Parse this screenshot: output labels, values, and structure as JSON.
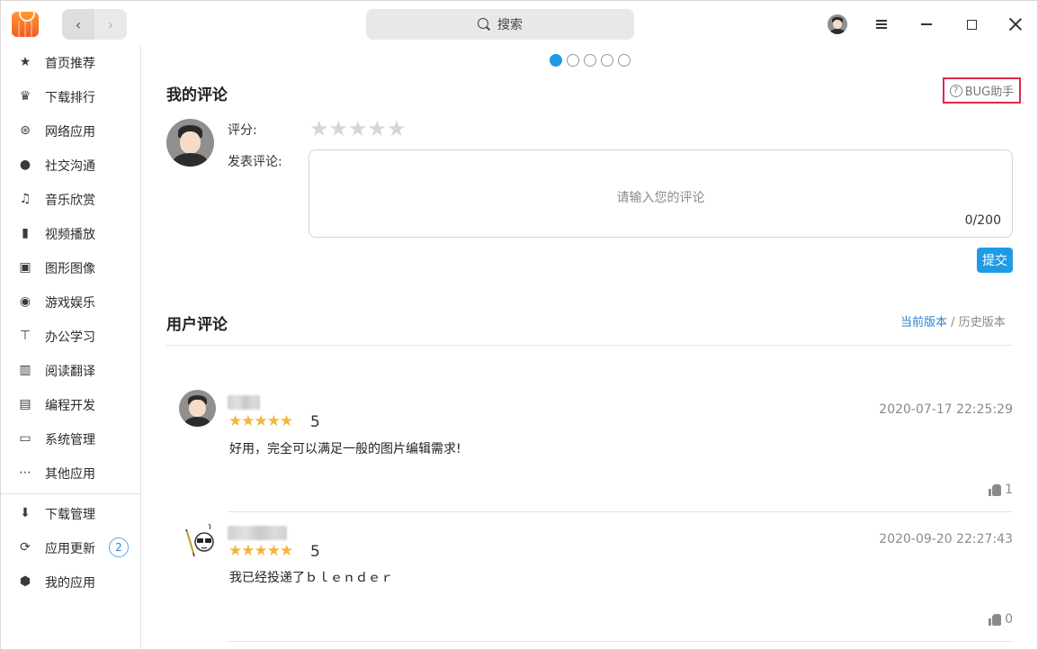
{
  "titlebar": {
    "search_label": "搜索"
  },
  "sidebar": {
    "items": [
      {
        "label": "首页推荐",
        "icon": "star-icon"
      },
      {
        "label": "下载排行",
        "icon": "crown-icon"
      },
      {
        "label": "网络应用",
        "icon": "globe-icon"
      },
      {
        "label": "社交沟通",
        "icon": "chat-icon"
      },
      {
        "label": "音乐欣赏",
        "icon": "music-note-icon"
      },
      {
        "label": "视频播放",
        "icon": "film-icon"
      },
      {
        "label": "图形图像",
        "icon": "image-icon"
      },
      {
        "label": "游戏娱乐",
        "icon": "gamepad-icon"
      },
      {
        "label": "办公学习",
        "icon": "presentation-icon"
      },
      {
        "label": "阅读翻译",
        "icon": "book-icon"
      },
      {
        "label": "编程开发",
        "icon": "terminal-icon"
      },
      {
        "label": "系统管理",
        "icon": "system-icon"
      },
      {
        "label": "其他应用",
        "icon": "more-icon"
      }
    ],
    "bottom_items": [
      {
        "label": "下载管理",
        "icon": "download-icon"
      },
      {
        "label": "应用更新",
        "icon": "refresh-icon",
        "badge": "2"
      },
      {
        "label": "我的应用",
        "icon": "box-icon"
      }
    ]
  },
  "my_review": {
    "title": "我的评论",
    "bug_helper": "BUG助手",
    "rating_label": "评分:",
    "comment_label": "发表评论:",
    "comment_placeholder": "请输入您的评论",
    "char_count": "0/200",
    "submit_label": "提交",
    "rating_stars": "★★★★★"
  },
  "user_reviews": {
    "title": "用户评论",
    "current_version": "当前版本",
    "separator": "/",
    "history_version": "历史版本",
    "items": [
      {
        "stars": "★★★★★",
        "score": "5",
        "date": "2020-07-17 22:25:29",
        "text": "好用，完全可以满足一般的图片编辑需求!",
        "likes": "1"
      },
      {
        "stars": "★★★★★",
        "score": "5",
        "date": "2020-09-20 22:27:43",
        "text": "我已经投递了ｂｌｅｎｄｅｒ",
        "likes": "0"
      }
    ]
  },
  "colors": {
    "accent": "#1f9be5",
    "star": "#f3b53b",
    "highlight_border": "#e0294a"
  },
  "carousel": {
    "total": 5,
    "active": 1
  }
}
